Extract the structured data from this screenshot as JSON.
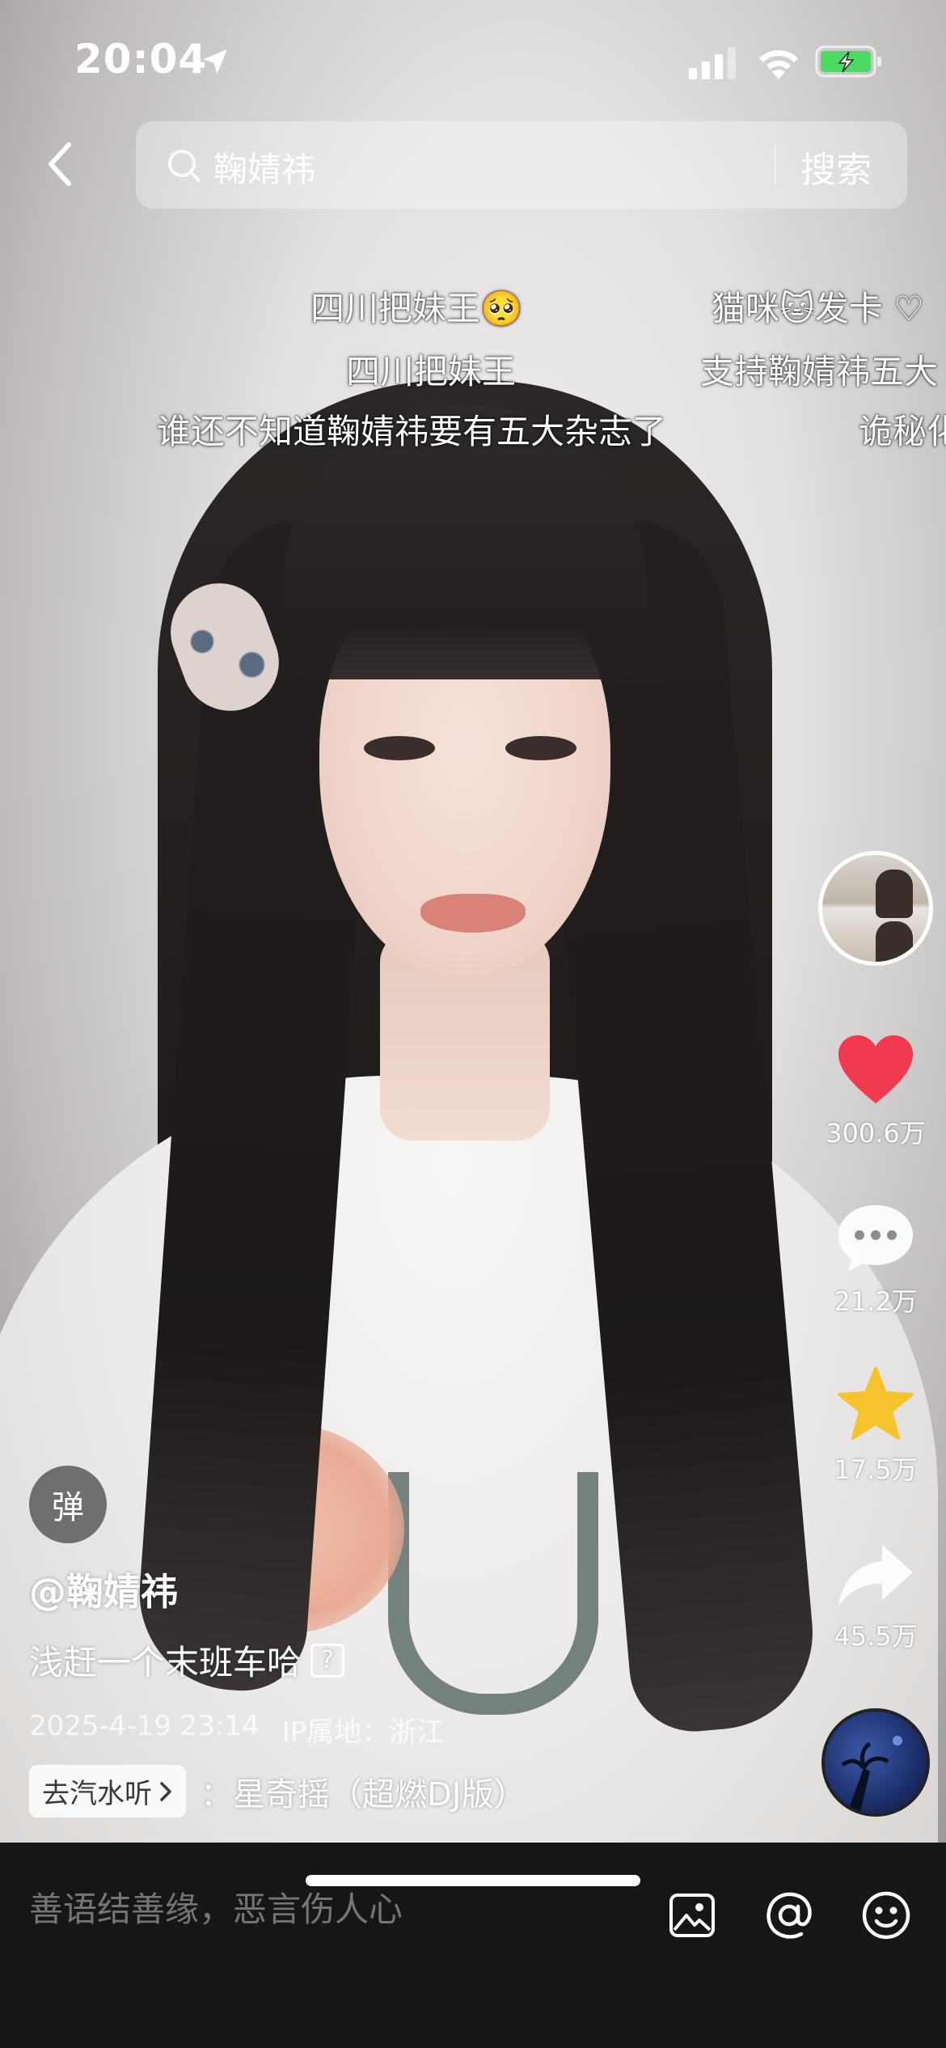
{
  "status_bar": {
    "time": "20:04"
  },
  "search": {
    "query": "鞠婧祎",
    "button_label": "搜索"
  },
  "danmaku": [
    "四川把妹王🥺",
    "猫咪🐱发卡 ♡",
    "四川把妹王",
    "支持鞠婧祎五大",
    "谁还不知道鞠婧祎要有五大杂志了",
    "诡秘化"
  ],
  "actions": {
    "likes": "300.6万",
    "comments": "21.2万",
    "favorites": "17.5万",
    "shares": "45.5万"
  },
  "danmu_toggle_label": "弹",
  "post": {
    "author": "@鞠婧祎",
    "description": "浅赶一个末班车哈",
    "date": "2025-4-19 23:14",
    "location": "IP属地：浙江"
  },
  "music": {
    "chip_label": "去汽水听",
    "title": "：星奇摇（超燃DJ版）"
  },
  "comment_bar": {
    "placeholder": "善语结善缘，恶言伤人心"
  },
  "colors": {
    "like_red": "#f1394f",
    "favorite_yellow": "#f7c32d",
    "comment_bar_bg": "#161616"
  },
  "icons": [
    "location-arrow-icon",
    "signal-icon",
    "wifi-icon",
    "battery-charging-icon",
    "back-chevron-icon",
    "search-icon",
    "heart-icon",
    "comment-bubble-icon",
    "star-icon",
    "share-arrow-icon",
    "image-icon",
    "at-icon",
    "emoji-icon"
  ]
}
